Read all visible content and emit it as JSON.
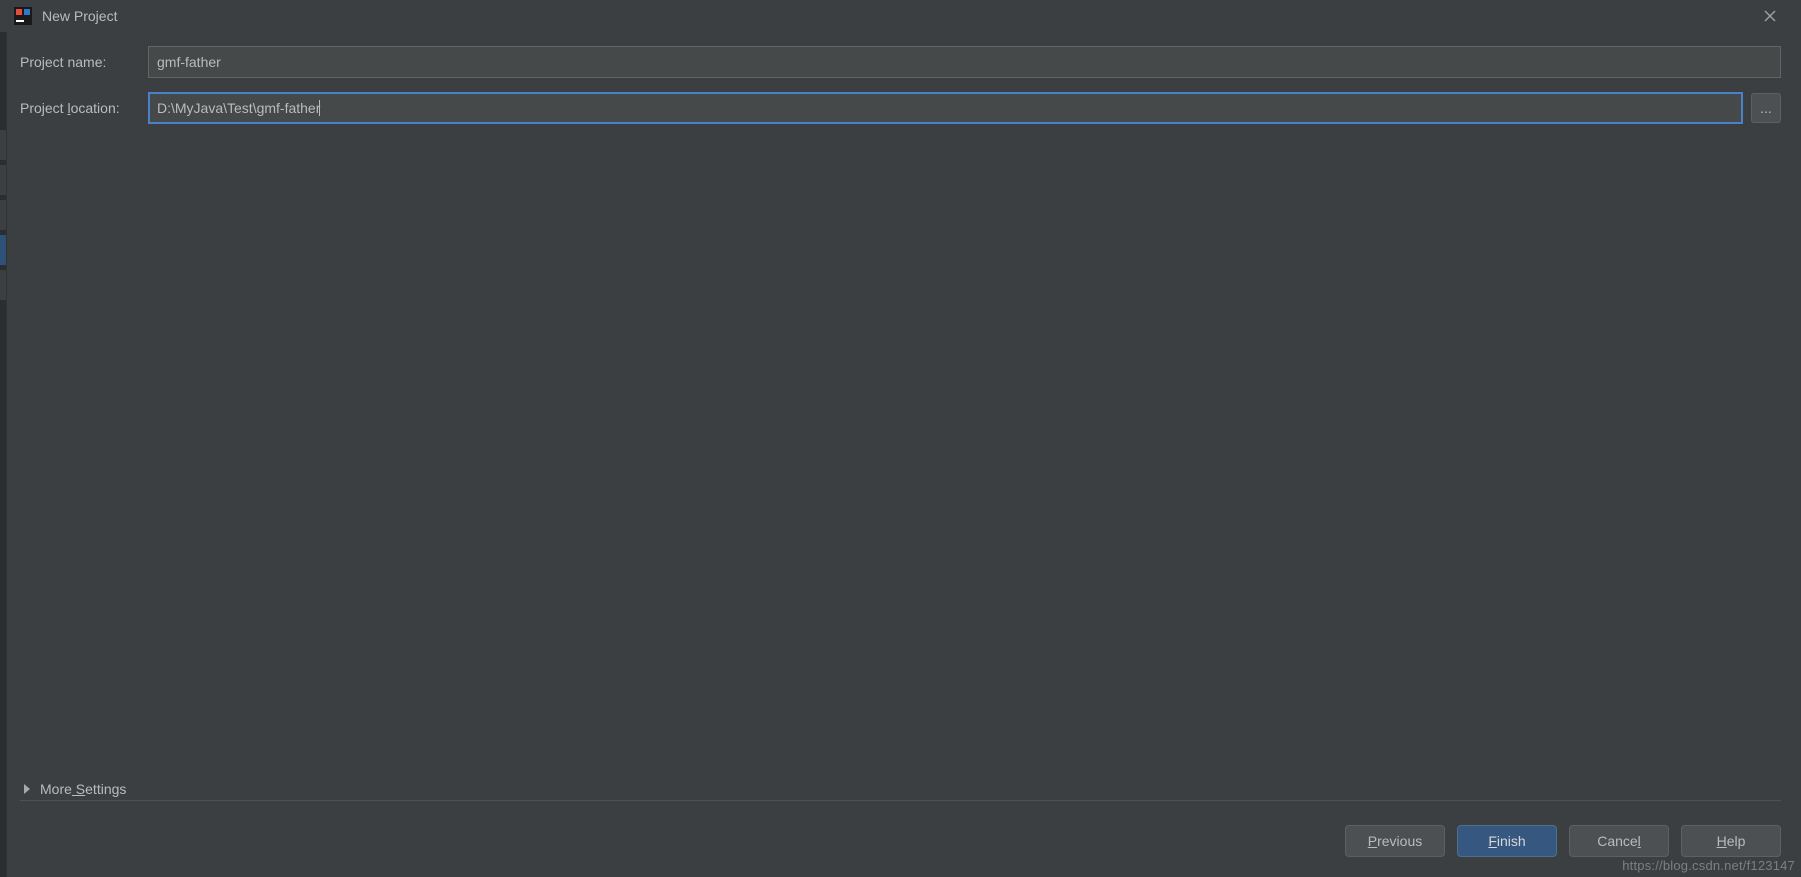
{
  "titleBar": {
    "title": "New Project"
  },
  "form": {
    "projectNameLabel": "Project name:",
    "projectNameValue": "gmf-father",
    "projectLocationLabelPre": "Project ",
    "projectLocationLabelU": "l",
    "projectLocationLabelPost": "ocation:",
    "projectLocationValue": "D:\\MyJava\\Test\\gmf-father",
    "browseLabel": "..."
  },
  "moreSettings": {
    "labelPre": "More",
    "labelU": " S",
    "labelPost": "ettings"
  },
  "buttons": {
    "previousU": "P",
    "previousRest": "revious",
    "finishU": "F",
    "finishRest": "inish",
    "cancelRest": "Cance",
    "cancelU": "l",
    "helpU": "H",
    "helpRest": "elp"
  },
  "watermark": "https://blog.csdn.net/f123147"
}
